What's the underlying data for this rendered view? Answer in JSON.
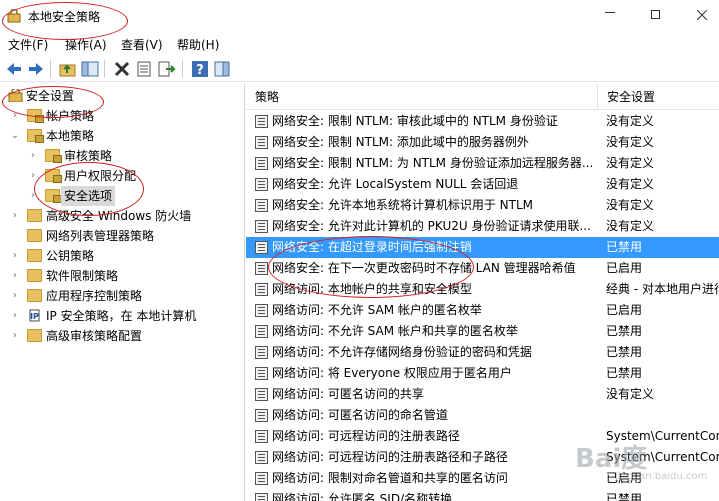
{
  "window": {
    "title": "本地安全策略"
  },
  "menu": [
    {
      "label": "文件(F)"
    },
    {
      "label": "操作(A)"
    },
    {
      "label": "查看(V)"
    },
    {
      "label": "帮助(H)"
    }
  ],
  "toolbar": {
    "buttons": [
      "back-icon",
      "forward-icon",
      "up-folder-icon",
      "show-tree-icon",
      "delete-icon",
      "properties-icon",
      "export-icon",
      "help-icon",
      "panel-icon"
    ]
  },
  "tree": [
    {
      "label": "安全设置",
      "expanded": true
    },
    {
      "label": "帐户策略"
    },
    {
      "label": "本地策略",
      "expanded": true
    },
    {
      "label": "审核策略"
    },
    {
      "label": "用户权限分配"
    },
    {
      "label": "安全选项",
      "selected": true
    },
    {
      "label": "高级安全 Windows 防火墙"
    },
    {
      "label": "网络列表管理器策略"
    },
    {
      "label": "公钥策略"
    },
    {
      "label": "软件限制策略"
    },
    {
      "label": "应用程序控制策略"
    },
    {
      "label": "IP 安全策略，在 本地计算机"
    },
    {
      "label": "高级审核策略配置"
    }
  ],
  "list": {
    "columns": [
      "策略",
      "安全设置"
    ],
    "rows": [
      {
        "name": "网络安全: 限制 NTLM: 审核此域中的 NTLM 身份验证",
        "value": "没有定义"
      },
      {
        "name": "网络安全: 限制 NTLM: 添加此域中的服务器例外",
        "value": "没有定义"
      },
      {
        "name": "网络安全: 限制 NTLM: 为 NTLM 身份验证添加远程服务器...",
        "value": "没有定义"
      },
      {
        "name": "网络安全: 允许 LocalSystem NULL 会话回退",
        "value": "没有定义"
      },
      {
        "name": "网络安全: 允许本地系统将计算机标识用于 NTLM",
        "value": "没有定义"
      },
      {
        "name": "网络安全: 允许对此计算机的 PKU2U 身份验证请求使用联...",
        "value": "没有定义"
      },
      {
        "name": "网络安全: 在超过登录时间后强制注销",
        "value": "已禁用",
        "selected": true
      },
      {
        "name": "网络安全: 在下一次更改密码时不存储 LAN 管理器哈希值",
        "value": "已启用"
      },
      {
        "name": "网络访问: 本地帐户的共享和安全模型",
        "value": "经典 - 对本地用户进行"
      },
      {
        "name": "网络访问: 不允许 SAM 帐户的匿名枚举",
        "value": "已启用"
      },
      {
        "name": "网络访问: 不允许 SAM 帐户和共享的匿名枚举",
        "value": "已禁用"
      },
      {
        "name": "网络访问: 不允许存储网络身份验证的密码和凭据",
        "value": "已禁用"
      },
      {
        "name": "网络访问: 将 Everyone 权限应用于匿名用户",
        "value": "已禁用"
      },
      {
        "name": "网络访问: 可匿名访问的共享",
        "value": "没有定义"
      },
      {
        "name": "网络访问: 可匿名访问的命名管道",
        "value": ""
      },
      {
        "name": "网络访问: 可远程访问的注册表路径",
        "value": "System\\CurrentCont"
      },
      {
        "name": "网络访问: 可远程访问的注册表路径和子路径",
        "value": "System\\CurrentCont"
      },
      {
        "name": "网络访问: 限制对命名管道和共享的匿名访问",
        "value": "已启用"
      },
      {
        "name": "网络访问: 允许匿名 SID/名称转换",
        "value": "已禁用"
      }
    ]
  },
  "watermark": {
    "text": "Bai度",
    "sub": "jingyan.baidu.com"
  },
  "colors": {
    "selection": "#3399ff",
    "annotation": "#d02020"
  }
}
